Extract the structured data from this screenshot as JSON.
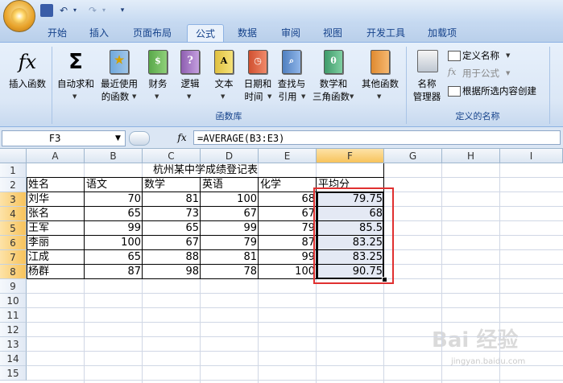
{
  "quick_access": {
    "undo_label": "↶",
    "redo_label": "↷",
    "more_label": "▾"
  },
  "tabs": [
    "开始",
    "插入",
    "页面布局",
    "公式",
    "数据",
    "审阅",
    "视图",
    "开发工具",
    "加载项"
  ],
  "active_tab": "公式",
  "ribbon": {
    "insert_function": "插入函数",
    "fx_glyph": "fx",
    "autosum_line1": "自动求和",
    "sigma_glyph": "Σ",
    "recent_line1": "最近使用",
    "recent_line2": "的函数",
    "financial": "财务",
    "logical": "逻辑",
    "text": "文本",
    "datetime_line1": "日期和",
    "datetime_line2": "时间",
    "lookup_line1": "查找与",
    "lookup_line2": "引用",
    "math_line1": "数学和",
    "math_line2": "三角函数",
    "more": "其他函数",
    "group_function_library": "函数库",
    "name_manager_line1": "名称",
    "name_manager_line2": "管理器",
    "define_name": "定义名称",
    "use_in_formula": "用于公式",
    "create_from_selection": "根据所选内容创建",
    "group_defined_names": "定义的名称",
    "logical_glyph": "?",
    "text_glyph": "A",
    "math_glyph": "θ"
  },
  "formula_bar": {
    "name_box": "F3",
    "fx_label": "fx",
    "formula": "=AVERAGE(B3:E3)"
  },
  "columns": [
    "A",
    "B",
    "C",
    "D",
    "E",
    "F",
    "G",
    "H",
    "I"
  ],
  "rows": [
    "1",
    "2",
    "3",
    "4",
    "5",
    "6",
    "7",
    "8",
    "9",
    "10",
    "11",
    "12",
    "13",
    "14",
    "15"
  ],
  "sheet": {
    "title": "杭州某中学成绩登记表",
    "headers": [
      "姓名",
      "语文",
      "数学",
      "英语",
      "化学",
      "平均分"
    ],
    "data": [
      [
        "刘华",
        "70",
        "81",
        "100",
        "68",
        "79.75"
      ],
      [
        "张名",
        "65",
        "73",
        "67",
        "67",
        "68"
      ],
      [
        "王军",
        "99",
        "65",
        "99",
        "79",
        "85.5"
      ],
      [
        "李丽",
        "100",
        "67",
        "79",
        "87",
        "83.25"
      ],
      [
        "江成",
        "65",
        "88",
        "81",
        "99",
        "83.25"
      ],
      [
        "杨群",
        "87",
        "98",
        "78",
        "100",
        "90.75"
      ]
    ]
  },
  "watermark": "Bai 经验",
  "watermark_sub": "jingyan.baidu.com",
  "colors": {
    "accent": "#15428b",
    "highlight_border": "#e03030",
    "selection_fill": "#e4e9f4"
  }
}
